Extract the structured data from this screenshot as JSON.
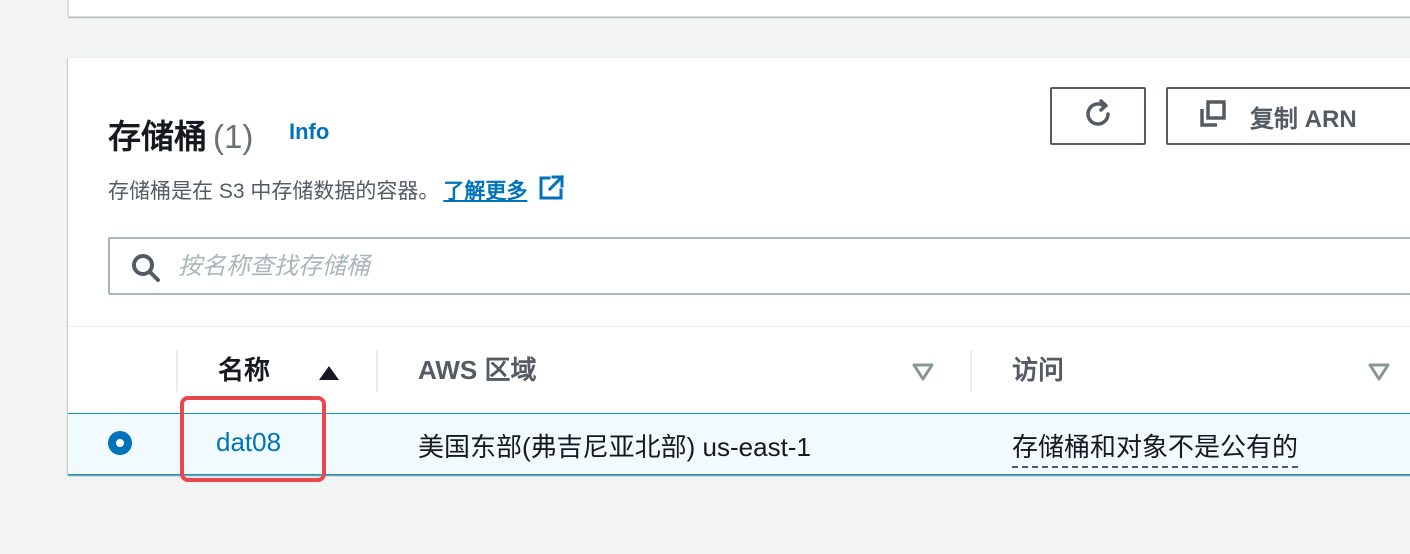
{
  "header": {
    "title": "存储桶",
    "count": "(1)",
    "info": "Info",
    "description": "存储桶是在 S3 中存储数据的容器。",
    "learn_more": "了解更多"
  },
  "actions": {
    "refresh_icon": "refresh-icon",
    "copy_arn_label": "复制 ARN"
  },
  "search": {
    "placeholder": "按名称查找存储桶",
    "value": ""
  },
  "table": {
    "columns": [
      {
        "label": "名称",
        "sort": "ascending"
      },
      {
        "label": "AWS 区域",
        "sort": "none"
      },
      {
        "label": "访问",
        "sort": "none"
      }
    ],
    "rows": [
      {
        "name": "dat08",
        "region": "美国东部(弗吉尼亚北部) us-east-1",
        "access": "存储桶和对象不是公有的",
        "selected": true
      }
    ]
  },
  "colors": {
    "link": "#0073bb",
    "highlight": "#e8474d",
    "selected_row": "#f1faff"
  }
}
